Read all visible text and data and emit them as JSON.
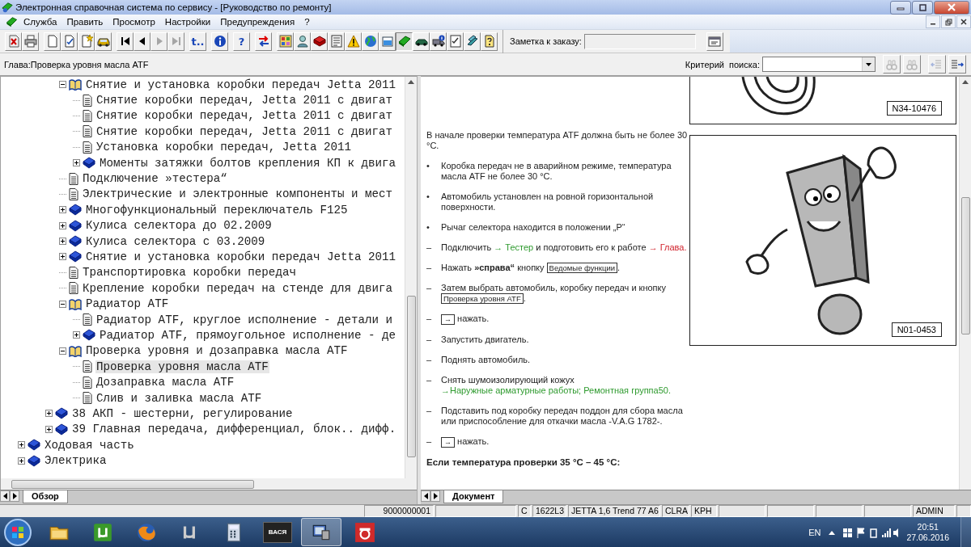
{
  "window": {
    "title": "Электронная справочная система по сервису - [Руководство по ремонту]"
  },
  "menu": [
    "Служба",
    "Править",
    "Просмотр",
    "Настройки",
    "Предупреждения",
    "?"
  ],
  "toolbar": {
    "groups": [
      [
        {
          "pressed": false,
          "disabled": false
        },
        {
          "pressed": false,
          "disabled": false
        }
      ],
      [
        {
          "pressed": false,
          "disabled": false
        },
        {
          "pressed": false,
          "disabled": false
        },
        {
          "pressed": false,
          "disabled": false
        },
        {
          "pressed": false,
          "disabled": false
        }
      ],
      [
        {
          "pressed": false,
          "disabled": false
        },
        {
          "pressed": false,
          "disabled": false
        },
        {
          "pressed": false,
          "disabled": true
        },
        {
          "pressed": false,
          "disabled": true
        }
      ],
      [
        {
          "text": "t..",
          "pressed": false,
          "disabled": false
        }
      ],
      [
        {
          "pressed": false,
          "disabled": false
        }
      ],
      [
        {
          "text": "?",
          "pressed": false,
          "disabled": false
        }
      ],
      [
        {
          "pressed": false,
          "disabled": false
        }
      ],
      [
        {
          "pressed": false,
          "disabled": false
        },
        {
          "pressed": false,
          "disabled": false
        },
        {
          "pressed": false,
          "disabled": false
        },
        {
          "pressed": false,
          "disabled": false
        },
        {
          "pressed": false,
          "disabled": false
        },
        {
          "pressed": false,
          "disabled": false
        },
        {
          "pressed": false,
          "disabled": false
        },
        {
          "pressed": true,
          "disabled": false
        },
        {
          "pressed": false,
          "disabled": false
        },
        {
          "pressed": false,
          "disabled": false
        },
        {
          "pressed": false,
          "disabled": false
        },
        {
          "pressed": false,
          "disabled": false
        },
        {
          "pressed": false,
          "disabled": false
        }
      ]
    ],
    "note": {
      "label": "Заметка к заказу:"
    }
  },
  "chapter": {
    "title": "Глава:Проверка уровня масла ATF"
  },
  "search": {
    "label": "Критерий  поиска:",
    "buttons": [
      {
        "disabled": true
      },
      {
        "disabled": true
      },
      {
        "disabled": true
      },
      {
        "disabled": false
      }
    ]
  },
  "tree": {
    "items": [
      {
        "children": [
          {
            "children": [
              {
                "children": [
                  {
                    "label": "Снятие и установка коробки передач Jetta 2011",
                    "expanded": true,
                    "selected": false,
                    "children": [
                      {
                        "label": "Снятие коробки передач, Jetta 2011 с двигат",
                        "selected": false
                      },
                      {
                        "label": "Снятие коробки передач, Jetta 2011 с двигат",
                        "selected": false
                      },
                      {
                        "label": "Снятие коробки передач, Jetta 2011 с двигат",
                        "selected": false
                      },
                      {
                        "label": "Установка коробки передач, Jetta 2011",
                        "selected": false
                      },
                      {
                        "label": "Моменты затяжки болтов крепления КП к двига",
                        "expanded": false,
                        "selected": false
                      }
                    ]
                  },
                  {
                    "label": "Подключение »тестера“",
                    "selected": false
                  },
                  {
                    "label": "Электрические и электронные компоненты и мест",
                    "selected": false
                  },
                  {
                    "label": "Многофункциональный переключатель F125",
                    "expanded": false,
                    "selected": false
                  },
                  {
                    "label": "Кулиса селектора до 02.2009",
                    "expanded": false,
                    "selected": false
                  },
                  {
                    "label": "Кулиса селектора с 03.2009",
                    "expanded": false,
                    "selected": false
                  },
                  {
                    "label": "Снятие и установка коробки передач Jetta 2011",
                    "expanded": false,
                    "selected": false
                  },
                  {
                    "label": "Транспортировка коробки передач",
                    "selected": false
                  },
                  {
                    "label": "Крепление коробки передач на стенде для двига",
                    "selected": false
                  },
                  {
                    "label": "Радиатор ATF",
                    "expanded": true,
                    "selected": false,
                    "children": [
                      {
                        "label": "Радиатор ATF, круглое исполнение - детали и",
                        "selected": false
                      },
                      {
                        "label": "Радиатор ATF, прямоугольное исполнение - де",
                        "expanded": false,
                        "selected": false
                      }
                    ]
                  },
                  {
                    "label": "Проверка уровня и дозаправка масла ATF",
                    "expanded": true,
                    "selected": false,
                    "children": [
                      {
                        "label": "Проверка уровня масла ATF",
                        "selected": true
                      },
                      {
                        "label": "Дозаправка масла ATF",
                        "selected": false
                      },
                      {
                        "label": "Слив и заливка масла ATF",
                        "selected": false
                      }
                    ]
                  }
                ]
              },
              {
                "label": "38 АКП - шестерни, регулирование",
                "expanded": false,
                "selected": false
              },
              {
                "label": "39 Главная передача, дифференциал, блок.. дифф.",
                "expanded": false,
                "selected": false
              }
            ]
          }
        ]
      },
      {
        "label": "Ходовая часть",
        "expanded": false,
        "selected": false
      },
      {
        "label": "Электрика",
        "expanded": false,
        "selected": false
      }
    ]
  },
  "tree_tabs": [
    {
      "label": "Обзор",
      "selected": true
    }
  ],
  "document": {
    "blocks": [
      {
        "parts": [
          {
            "kind": "text",
            "text": "В начале проверки температура ATF должна быть не более 30 °C."
          }
        ]
      },
      {
        "marker": "•",
        "parts": [
          {
            "kind": "text",
            "text": "Коробка передач не в аварийном режиме, температура масла ATF не более 30 °C."
          }
        ]
      },
      {
        "marker": "•",
        "parts": [
          {
            "kind": "text",
            "text": "Автомобиль установлен на ровной горизонтальной поверхности."
          }
        ]
      },
      {
        "marker": "•",
        "parts": [
          {
            "kind": "text",
            "text": "Рычаг селектора находится в положении „P“"
          }
        ]
      },
      {
        "marker": "–",
        "parts": [
          {
            "kind": "text",
            "text": "Подключить "
          },
          {
            "kind": "link",
            "text": "→ Тестер"
          },
          {
            "kind": "text",
            "text": " и подготовить его к работе "
          },
          {
            "kind": "ref",
            "text": "→ Глава."
          }
        ]
      },
      {
        "marker": "–",
        "parts": [
          {
            "kind": "text",
            "text": "Нажать "
          },
          {
            "kind": "bold",
            "text": "»справа“"
          },
          {
            "kind": "text",
            "text": " кнопку "
          },
          {
            "kind": "button",
            "text": "Ведомые функции"
          },
          {
            "kind": "text",
            "text": "."
          }
        ]
      },
      {
        "marker": "–",
        "parts": [
          {
            "kind": "text",
            "text": "Затем выбрать автомобиль, коробку передач и кнопку "
          },
          {
            "kind": "button",
            "text": "Проверка уровня ATF"
          },
          {
            "kind": "text",
            "text": "."
          }
        ]
      },
      {
        "marker": "–",
        "parts": [
          {
            "kind": "key",
            "text": "→"
          },
          {
            "kind": "text",
            "text": " нажать."
          }
        ]
      },
      {
        "marker": "–",
        "parts": [
          {
            "kind": "text",
            "text": "Запустить двигатель."
          }
        ]
      },
      {
        "marker": "–",
        "parts": [
          {
            "kind": "text",
            "text": "Поднять автомобиль."
          }
        ]
      },
      {
        "marker": "–",
        "parts": [
          {
            "kind": "text",
            "text": "Снять шумоизолирующий кожух "
          },
          {
            "kind": "link",
            "text": "→Наружные "
          },
          {
            "kind": "link",
            "text": "арматурные работы; "
          },
          {
            "kind": "link",
            "text": "Ремонтная группа50."
          }
        ]
      },
      {
        "marker": "–",
        "parts": [
          {
            "kind": "text",
            "text": "Подставить под коробку передач поддон для сбора масла или приспособление для откачки масла -V.A.G 1782-."
          }
        ]
      },
      {
        "marker": "–",
        "parts": [
          {
            "kind": "key",
            "text": "→"
          },
          {
            "kind": "text",
            "text": " нажать."
          }
        ]
      },
      {
        "kind": "heading",
        "parts": [
          {
            "kind": "text",
            "text": "Если температура проверки 35 °C – 45 °C:"
          }
        ]
      }
    ],
    "figures": [
      {
        "label": "N34-10476"
      },
      {
        "label": "N01-0453"
      }
    ]
  },
  "document_tabs": [
    {
      "label": "Документ",
      "selected": true
    }
  ],
  "status_bar": [
    "9000000001",
    "C",
    "1622L3",
    "JETTA 1,6 Trend 77 A6",
    "CLRA",
    "KPH",
    "ADMIN"
  ],
  "taskbar": {
    "apps": [
      {
        "selected": false
      },
      {
        "selected": false
      },
      {
        "selected": false
      },
      {
        "selected": false
      },
      {
        "selected": false
      },
      {
        "text": "ВАСЯ",
        "selected": false
      },
      {
        "selected": true
      },
      {
        "selected": false
      }
    ],
    "language": "EN",
    "time": "20:51",
    "date": "27.06.2016"
  }
}
